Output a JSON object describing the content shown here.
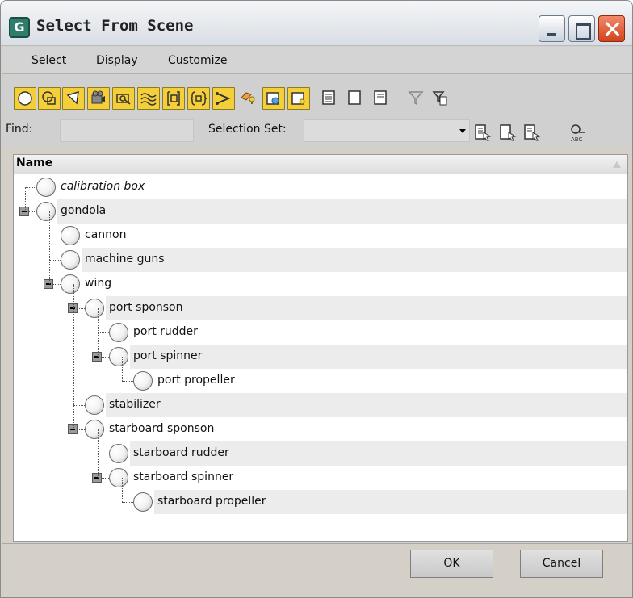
{
  "window": {
    "title": "Select From Scene",
    "app_icon_glyph": "G",
    "controls": [
      "minimize-icon",
      "maximize-icon",
      "close-icon"
    ]
  },
  "menu": {
    "items": [
      "Select",
      "Display",
      "Customize"
    ]
  },
  "toolbar": {
    "filter_buttons": [
      {
        "icon": "geometry-sphere-icon",
        "active": true
      },
      {
        "icon": "shapes-icon",
        "active": true
      },
      {
        "icon": "lights-icon",
        "active": true
      },
      {
        "icon": "cameras-icon",
        "active": true
      },
      {
        "icon": "helpers-icon",
        "active": true
      },
      {
        "icon": "space-warps-icon",
        "active": true
      },
      {
        "icon": "groups-icon",
        "active": true
      },
      {
        "icon": "xrefs-icon",
        "active": true
      },
      {
        "icon": "bones-icon",
        "active": true
      },
      {
        "icon": "containers-icon",
        "active": false
      },
      {
        "icon": "frozen-icon",
        "active": true
      },
      {
        "icon": "hidden-icon",
        "active": true
      }
    ],
    "tool_buttons": [
      "select-all-icon",
      "select-none-icon",
      "invert-selection-icon",
      "filter-icon",
      "filter-options-icon"
    ]
  },
  "find": {
    "label": "Find:",
    "value": "",
    "selection_set_label": "Selection Set:",
    "selection_set_value": ""
  },
  "list": {
    "header": "Name",
    "nodes": [
      {
        "label": "calibration box",
        "depth": 0,
        "italic": true,
        "expandable": false
      },
      {
        "label": "gondola",
        "depth": 0,
        "italic": false,
        "expandable": true
      },
      {
        "label": "cannon",
        "depth": 1,
        "italic": false,
        "expandable": false
      },
      {
        "label": "machine guns",
        "depth": 1,
        "italic": false,
        "expandable": false
      },
      {
        "label": "wing",
        "depth": 1,
        "italic": false,
        "expandable": true
      },
      {
        "label": "port sponson",
        "depth": 2,
        "italic": false,
        "expandable": true
      },
      {
        "label": "port rudder",
        "depth": 3,
        "italic": false,
        "expandable": false
      },
      {
        "label": "port spinner",
        "depth": 3,
        "italic": false,
        "expandable": true
      },
      {
        "label": "port propeller",
        "depth": 4,
        "italic": false,
        "expandable": false
      },
      {
        "label": "stabilizer",
        "depth": 2,
        "italic": false,
        "expandable": false
      },
      {
        "label": "starboard sponson",
        "depth": 2,
        "italic": false,
        "expandable": true
      },
      {
        "label": "starboard rudder",
        "depth": 3,
        "italic": false,
        "expandable": false
      },
      {
        "label": "starboard spinner",
        "depth": 3,
        "italic": false,
        "expandable": true
      },
      {
        "label": "starboard propeller",
        "depth": 4,
        "italic": false,
        "expandable": false
      }
    ]
  },
  "buttons": {
    "ok": "OK",
    "cancel": "Cancel"
  },
  "colors": {
    "toolbar_active": "#f4cf3a",
    "row_alt": "#ececec",
    "chrome": "#d4d0c8"
  }
}
